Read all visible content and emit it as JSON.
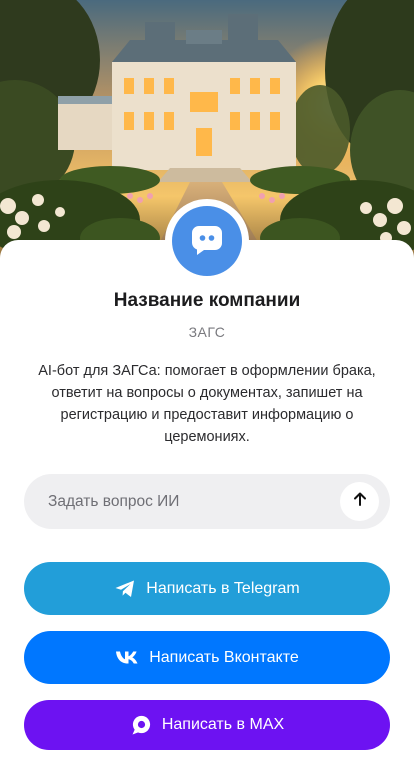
{
  "company": {
    "name": "Название компании",
    "category": "ЗАГС",
    "description": "AI-бот для ЗАГСа: помогает в оформлении брака, ответит на вопросы о документах, запишет на регистрацию и предоставит информацию о церемониях."
  },
  "hero": {
    "image": "palace-garden-sunset-illustration"
  },
  "avatar": {
    "icon": "chat-bubble-icon",
    "color": "#4a8fe7"
  },
  "ask": {
    "placeholder": "Задать вопрос ИИ",
    "value": "",
    "send_icon": "arrow-up-icon"
  },
  "buttons": [
    {
      "label": "Написать в Telegram",
      "icon": "telegram-icon",
      "color": "#229ed9"
    },
    {
      "label": "Написать Вконтакте",
      "icon": "vk-icon",
      "color": "#0077ff"
    },
    {
      "label": "Написать в MAX",
      "icon": "max-icon",
      "color": "#6d12f2"
    }
  ]
}
